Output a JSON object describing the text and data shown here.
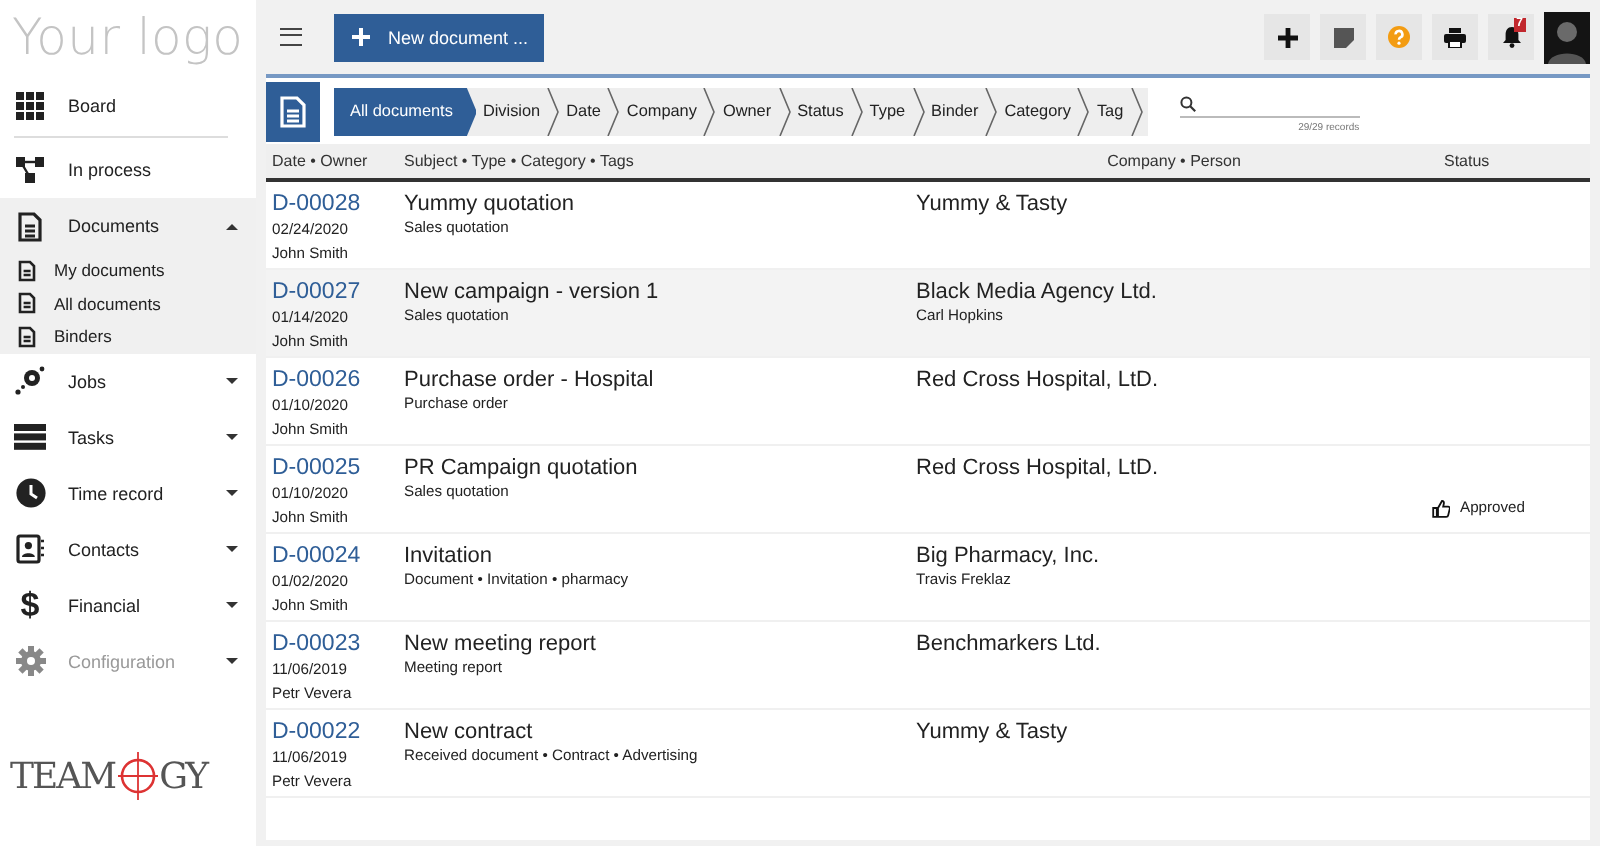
{
  "logo": {
    "text": "Your logo"
  },
  "sidebar": {
    "items": [
      {
        "label": "Board"
      },
      {
        "label": "In process"
      },
      {
        "label": "Documents",
        "expanded": true,
        "children": [
          {
            "label": "My documents"
          },
          {
            "label": "All documents"
          },
          {
            "label": "Binders"
          }
        ]
      },
      {
        "label": "Jobs",
        "expanded": false
      },
      {
        "label": "Tasks",
        "expanded": false
      },
      {
        "label": "Time record",
        "expanded": false
      },
      {
        "label": "Contacts",
        "expanded": false
      },
      {
        "label": "Financial",
        "glyph": "$",
        "expanded": false
      },
      {
        "label": "Configuration",
        "expanded": false,
        "disabled": true
      }
    ]
  },
  "brand": {
    "before": "TEAM",
    "after": "GY"
  },
  "toolbar": {
    "new_button": "New document ...",
    "actions": [
      {
        "kind": "plus"
      },
      {
        "kind": "note"
      },
      {
        "kind": "help"
      },
      {
        "kind": "print"
      },
      {
        "kind": "bell",
        "badge": "7"
      },
      {
        "kind": "avatar"
      }
    ]
  },
  "filters": [
    {
      "label": "All documents",
      "selected": true
    },
    {
      "label": "Division",
      "selected": false
    },
    {
      "label": "Date",
      "selected": false
    },
    {
      "label": "Company",
      "selected": false
    },
    {
      "label": "Owner",
      "selected": false
    },
    {
      "label": "Status",
      "selected": false
    },
    {
      "label": "Type",
      "selected": false
    },
    {
      "label": "Binder",
      "selected": false
    },
    {
      "label": "Category",
      "selected": false
    },
    {
      "label": "Tag",
      "selected": false
    }
  ],
  "search": {
    "count": "29/29 records"
  },
  "table": {
    "columns": [
      "Date • Owner",
      "Subject • Type • Category • Tags",
      "Company • Person",
      "Status"
    ],
    "rows": [
      {
        "id": "D-00028",
        "date": "02/24/2020",
        "owner": "John Smith",
        "subject": "Yummy quotation",
        "type": "Sales quotation",
        "company": "Yummy & Tasty",
        "highlighted": false
      },
      {
        "id": "D-00027",
        "date": "01/14/2020",
        "owner": "John Smith",
        "subject": "New campaign - version 1",
        "type": "Sales quotation",
        "company": "Black Media Agency Ltd.",
        "person": "Carl Hopkins",
        "highlighted": true
      },
      {
        "id": "D-00026",
        "date": "01/10/2020",
        "owner": "John Smith",
        "subject": "Purchase order - Hospital",
        "type": "Purchase order",
        "company": "Red Cross Hospital, LtD.",
        "highlighted": false
      },
      {
        "id": "D-00025",
        "date": "01/10/2020",
        "owner": "John Smith",
        "subject": "PR Campaign quotation",
        "type": "Sales quotation",
        "company": "Red Cross Hospital, LtD.",
        "status": "Approved",
        "highlighted": false
      },
      {
        "id": "D-00024",
        "date": "01/02/2020",
        "owner": "John Smith",
        "subject": "Invitation",
        "type": "Document • Invitation • pharmacy",
        "company": "Big Pharmacy, Inc.",
        "person": "Travis Freklaz",
        "highlighted": false
      },
      {
        "id": "D-00023",
        "date": "11/06/2019",
        "owner": "Petr Vevera",
        "subject": "New meeting report",
        "type": "Meeting report",
        "company": "Benchmarkers Ltd.",
        "highlighted": false
      },
      {
        "id": "D-00022",
        "date": "11/06/2019",
        "owner": "Petr Vevera",
        "subject": "New contract",
        "type": "Received document • Contract • Advertising",
        "company": "Yummy & Tasty",
        "highlighted": false
      }
    ]
  }
}
